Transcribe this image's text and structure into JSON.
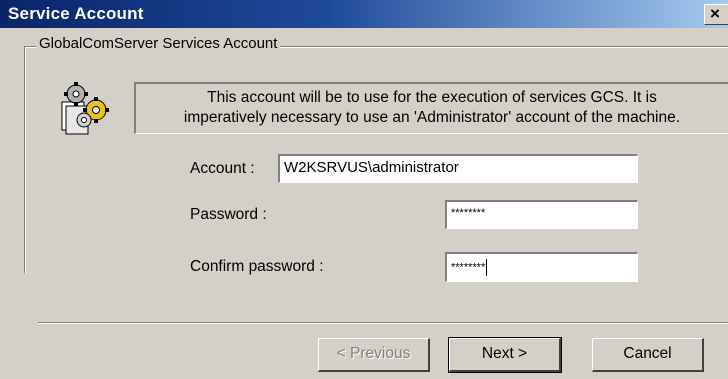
{
  "window": {
    "title": "Service Account",
    "close_glyph": "×"
  },
  "group": {
    "label": "GlobalComServer Services Account",
    "icon": "gears-services-icon"
  },
  "info": {
    "line1": "This account will be to use for the execution of services GCS.  It is",
    "line2": "imperatively necessary to use an 'Administrator' account of the machine."
  },
  "form": {
    "account_label": "Account :",
    "account_value": "W2KSRVUS\\administrator",
    "password_label": "Password :",
    "password_value": "********",
    "confirm_label": "Confirm password :",
    "confirm_value": "********"
  },
  "buttons": {
    "previous": "< Previous",
    "next": "Next >",
    "cancel": "Cancel"
  },
  "colors": {
    "title_bar": "#0a246a",
    "dialog_face": "#d4d0c8"
  }
}
